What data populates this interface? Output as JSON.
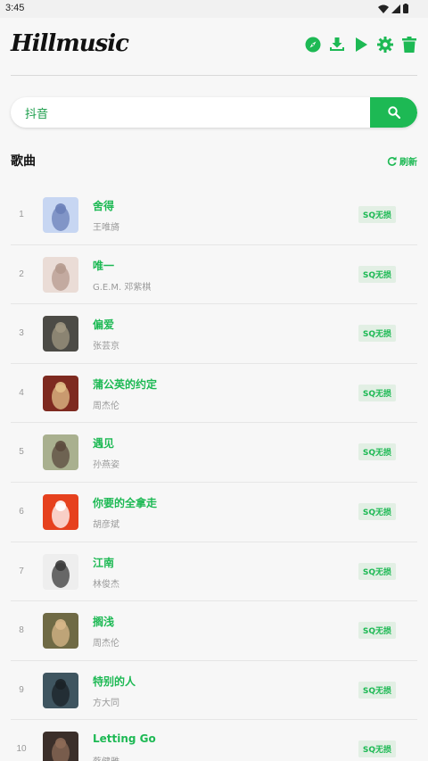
{
  "status_bar": {
    "time": "3:45"
  },
  "app": {
    "title": "Hillmusic"
  },
  "header": {
    "actions": [
      "compass-icon",
      "download-icon",
      "play-icon",
      "settings-icon",
      "trash-icon"
    ]
  },
  "search": {
    "value": "抖音",
    "placeholder": ""
  },
  "section": {
    "title": "歌曲",
    "refresh_label": "刷新"
  },
  "colors": {
    "accent": "#1db954",
    "badge_bg": "#e2efe4",
    "text_muted": "#9a9a9a"
  },
  "songs": [
    {
      "num": "1",
      "title": "舍得",
      "artist": "王唯旖",
      "badge": "SQ无损",
      "cover": {
        "bg": "#c7d6f2",
        "fg": "#6a7fb8"
      }
    },
    {
      "num": "2",
      "title": "唯一",
      "artist": "G.E.M. 邓紫棋",
      "badge": "SQ无损",
      "cover": {
        "bg": "#eadcd6",
        "fg": "#b59a8e"
      }
    },
    {
      "num": "3",
      "title": "偏爱",
      "artist": "张芸京",
      "badge": "SQ无损",
      "cover": {
        "bg": "#4c4b46",
        "fg": "#a09782"
      }
    },
    {
      "num": "4",
      "title": "蒲公英的约定",
      "artist": "周杰伦",
      "badge": "SQ无损",
      "cover": {
        "bg": "#7e2a20",
        "fg": "#e3c08a"
      }
    },
    {
      "num": "5",
      "title": "遇见",
      "artist": "孙燕姿",
      "badge": "SQ无损",
      "cover": {
        "bg": "#a9b08f",
        "fg": "#5b4a3d"
      }
    },
    {
      "num": "6",
      "title": "你要的全拿走",
      "artist": "胡彦斌",
      "badge": "SQ无损",
      "cover": {
        "bg": "#e6411e",
        "fg": "#ffffff"
      }
    },
    {
      "num": "7",
      "title": "江南",
      "artist": "林俊杰",
      "badge": "SQ无损",
      "cover": {
        "bg": "#eeeeee",
        "fg": "#3a3a3a"
      }
    },
    {
      "num": "8",
      "title": "搁浅",
      "artist": "周杰伦",
      "badge": "SQ无损",
      "cover": {
        "bg": "#6f6a45",
        "fg": "#d8b88a"
      }
    },
    {
      "num": "9",
      "title": "特别的人",
      "artist": "方大同",
      "badge": "SQ无损",
      "cover": {
        "bg": "#3f5560",
        "fg": "#1b2227"
      }
    },
    {
      "num": "10",
      "title": "Letting Go",
      "artist": "蔡健雅",
      "badge": "SQ无损",
      "cover": {
        "bg": "#3b2f2a",
        "fg": "#8e6c58"
      }
    }
  ]
}
